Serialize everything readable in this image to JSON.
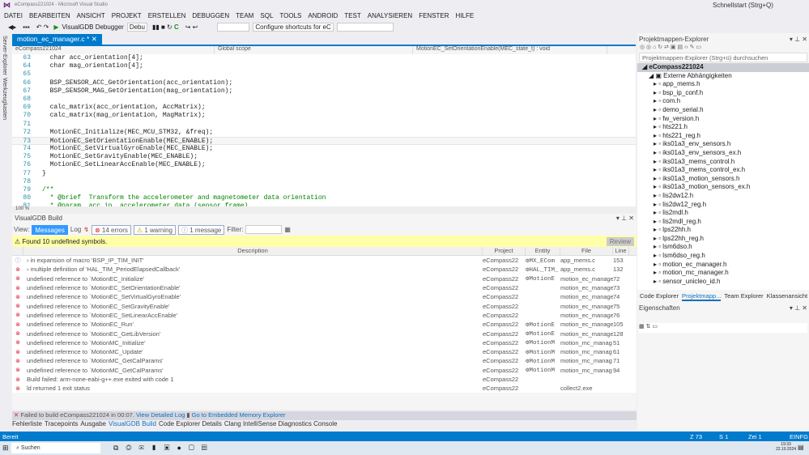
{
  "window": {
    "title": "eCompass221024 - Microsoft Visual Studio",
    "quick_launch": "Schnellstart (Strg+Q)"
  },
  "menu": [
    "DATEI",
    "BEARBEITEN",
    "ANSICHT",
    "PROJEKT",
    "ERSTELLEN",
    "DEBUGGEN",
    "TEAM",
    "SQL",
    "TOOLS",
    "ANDROID",
    "TEST",
    "ANALYSIEREN",
    "FENSTER",
    "HILFE"
  ],
  "toolbar": {
    "debugger": "VisualGDB Debugger",
    "config": "Debu",
    "shortcuts": "Configure shortcuts for eC"
  },
  "left_strip": [
    "Server-Explorer",
    "Werkzeugkasten"
  ],
  "editor": {
    "tab": "motion_ec_manager.c",
    "tab_modified": "*",
    "nav_project": "eCompass221024",
    "nav_scope": "Global scope",
    "nav_function": "MotionEC_SetOrientationEnable(MEC_state_t) : void",
    "zoom": "100 %",
    "lines": [
      {
        "n": "63",
        "t": "  char acc_orientation[4];",
        "k": "code"
      },
      {
        "n": "64",
        "t": "  char mag_orientation[4];",
        "k": "code"
      },
      {
        "n": "65",
        "t": "",
        "k": "code"
      },
      {
        "n": "66",
        "t": "  BSP_SENSOR_ACC_GetOrientation(acc_orientation);",
        "k": "code"
      },
      {
        "n": "67",
        "t": "  BSP_SENSOR_MAG_GetOrientation(mag_orientation);",
        "k": "code"
      },
      {
        "n": "68",
        "t": "",
        "k": "code"
      },
      {
        "n": "69",
        "t": "  calc_matrix(acc_orientation, AccMatrix);",
        "k": "code"
      },
      {
        "n": "70",
        "t": "  calc_matrix(mag_orientation, MagMatrix);",
        "k": "code"
      },
      {
        "n": "71",
        "t": "",
        "k": "code"
      },
      {
        "n": "72",
        "t": "  MotionEC_Initialize(MEC_MCU_STM32, &freq);",
        "k": "code"
      },
      {
        "n": "73",
        "t": "  MotionEC_SetOrientationEnable(MEC_ENABLE);",
        "k": "hl"
      },
      {
        "n": "74",
        "t": "  MotionEC_SetVirtualGyroEnable(MEC_ENABLE);",
        "k": "code"
      },
      {
        "n": "75",
        "t": "  MotionEC_SetGravityEnable(MEC_ENABLE);",
        "k": "code"
      },
      {
        "n": "76",
        "t": "  MotionEC_SetLinearAccEnable(MEC_ENABLE);",
        "k": "code"
      },
      {
        "n": "77",
        "t": "}",
        "k": "code"
      },
      {
        "n": "78",
        "t": "",
        "k": "code"
      },
      {
        "n": "79",
        "t": "/**",
        "k": "cm"
      },
      {
        "n": "80",
        "t": "  * @brief  Transform the accelerometer and magnetometer data orientation",
        "k": "cm"
      },
      {
        "n": "81",
        "t": "  * @param  acc_in  accelerometer data (sensor frame)",
        "k": "cm"
      }
    ]
  },
  "build": {
    "title": "VisualGDB Build",
    "view_label": "View:",
    "messages": "Messages",
    "log": "Log",
    "errors": "14 errors",
    "warnings": "1 warning",
    "messages_count": "1 message",
    "filter_label": "Filter:",
    "banner": "Found 10 undefined symbols.",
    "review": "Review",
    "columns": [
      "Description",
      "Project",
      "Entity",
      "File",
      "Line"
    ],
    "rows": [
      {
        "type": "info",
        "desc": "› in expansion of macro 'BSP_IP_TIM_INIT'",
        "project": "eCompass22",
        "entity": "MX_ECom",
        "file": "app_mems.c",
        "line": "153"
      },
      {
        "type": "error",
        "desc": "› multiple definition of 'HAL_TIM_PeriodElapsedCallback'",
        "project": "eCompass22",
        "entity": "HAL_TIM_",
        "file": "app_mems.c",
        "line": "132"
      },
      {
        "type": "error",
        "desc": "undefined reference to `MotionEC_Initialize'",
        "project": "eCompass22",
        "entity": "MotionE",
        "file": "motion_ec_manage",
        "line": "72"
      },
      {
        "type": "error",
        "desc": "undefined reference to `MotionEC_SetOrientationEnable'",
        "project": "eCompass22",
        "entity": "",
        "file": "motion_ec_manage",
        "line": "73"
      },
      {
        "type": "error",
        "desc": "undefined reference to `MotionEC_SetVirtualGyroEnable'",
        "project": "eCompass22",
        "entity": "",
        "file": "motion_ec_manage",
        "line": "74"
      },
      {
        "type": "error",
        "desc": "undefined reference to `MotionEC_SetGravityEnable'",
        "project": "eCompass22",
        "entity": "",
        "file": "motion_ec_manage",
        "line": "75"
      },
      {
        "type": "error",
        "desc": "undefined reference to `MotionEC_SetLinearAccEnable'",
        "project": "eCompass22",
        "entity": "",
        "file": "motion_ec_manage",
        "line": "76"
      },
      {
        "type": "error",
        "desc": "undefined reference to `MotionEC_Run'",
        "project": "eCompass22",
        "entity": "MotionE",
        "file": "motion_ec_manage",
        "line": "105"
      },
      {
        "type": "error",
        "desc": "undefined reference to `MotionEC_GetLibVersion'",
        "project": "eCompass22",
        "entity": "MotionE",
        "file": "motion_ec_manage",
        "line": "128"
      },
      {
        "type": "error",
        "desc": "undefined reference to `MotionMC_Initialize'",
        "project": "eCompass22",
        "entity": "MotionM",
        "file": "motion_mc_manag",
        "line": "51"
      },
      {
        "type": "error",
        "desc": "undefined reference to `MotionMC_Update'",
        "project": "eCompass22",
        "entity": "MotionM",
        "file": "motion_mc_manag",
        "line": "61"
      },
      {
        "type": "error",
        "desc": "undefined reference to `MotionMC_GetCalParams'",
        "project": "eCompass22",
        "entity": "MotionM",
        "file": "motion_mc_manag",
        "line": "71"
      },
      {
        "type": "error",
        "desc": "undefined reference to `MotionMC_GetCalParams'",
        "project": "eCompass22",
        "entity": "MotionM",
        "file": "motion_mc_manag",
        "line": "94"
      },
      {
        "type": "error",
        "desc": "Build failed: arm-none-eabi-g++.exe exited with code 1",
        "project": "eCompass22",
        "entity": "",
        "file": "",
        "line": ""
      },
      {
        "type": "error",
        "desc": "ld returned 1 exit status",
        "project": "eCompass22",
        "entity": "",
        "file": "collect2.exe",
        "line": ""
      }
    ],
    "footer": {
      "failed": "Failed to build eCompass221024 in 00:07.",
      "log_link": "View Detailed Log",
      "memory_link": "Go to Embedded Memory Explorer"
    }
  },
  "bottom_tabs": [
    "Fehlerliste",
    "Tracepoints",
    "Ausgabe",
    "VisualGDB Build",
    "Code Explorer Details",
    "Clang IntelliSense Diagnostics Console"
  ],
  "status": {
    "left": "Bereit",
    "line": "Z 73",
    "col": "S 1",
    "char": "Zei 1",
    "mode": "EINFG"
  },
  "taskbar": {
    "search": "Suchen",
    "time": "19:33",
    "date": "22.10.2024"
  },
  "solution_explorer": {
    "title": "Projektmappen-Explorer",
    "search_placeholder": "Projektmappen-Explorer (Strg+ü) durchsuchen",
    "project": "eCompass221024",
    "folder": "Externe Abhängigkeiten",
    "files": [
      "app_mems.h",
      "bsp_ip_conf.h",
      "com.h",
      "demo_serial.h",
      "fw_version.h",
      "hts221.h",
      "hts221_reg.h",
      "iks01a3_env_sensors.h",
      "iks01a3_env_sensors_ex.h",
      "iks01a3_mems_control.h",
      "iks01a3_mems_control_ex.h",
      "iks01a3_motion_sensors.h",
      "iks01a3_motion_sensors_ex.h",
      "lis2dw12.h",
      "lis2dw12_reg.h",
      "lis2mdl.h",
      "lis2mdl_reg.h",
      "lps22hh.h",
      "lps22hh_reg.h",
      "lsm6dso.h",
      "lsm6dso_reg.h",
      "motion_ec_manager.h",
      "motion_mc_manager.h",
      "sensor_unicleo_id.h"
    ],
    "tabs": [
      "Code Explorer",
      "Projektmapp...",
      "Team Explorer",
      "Klassenansicht"
    ]
  },
  "properties": {
    "title": "Eigenschaften"
  }
}
